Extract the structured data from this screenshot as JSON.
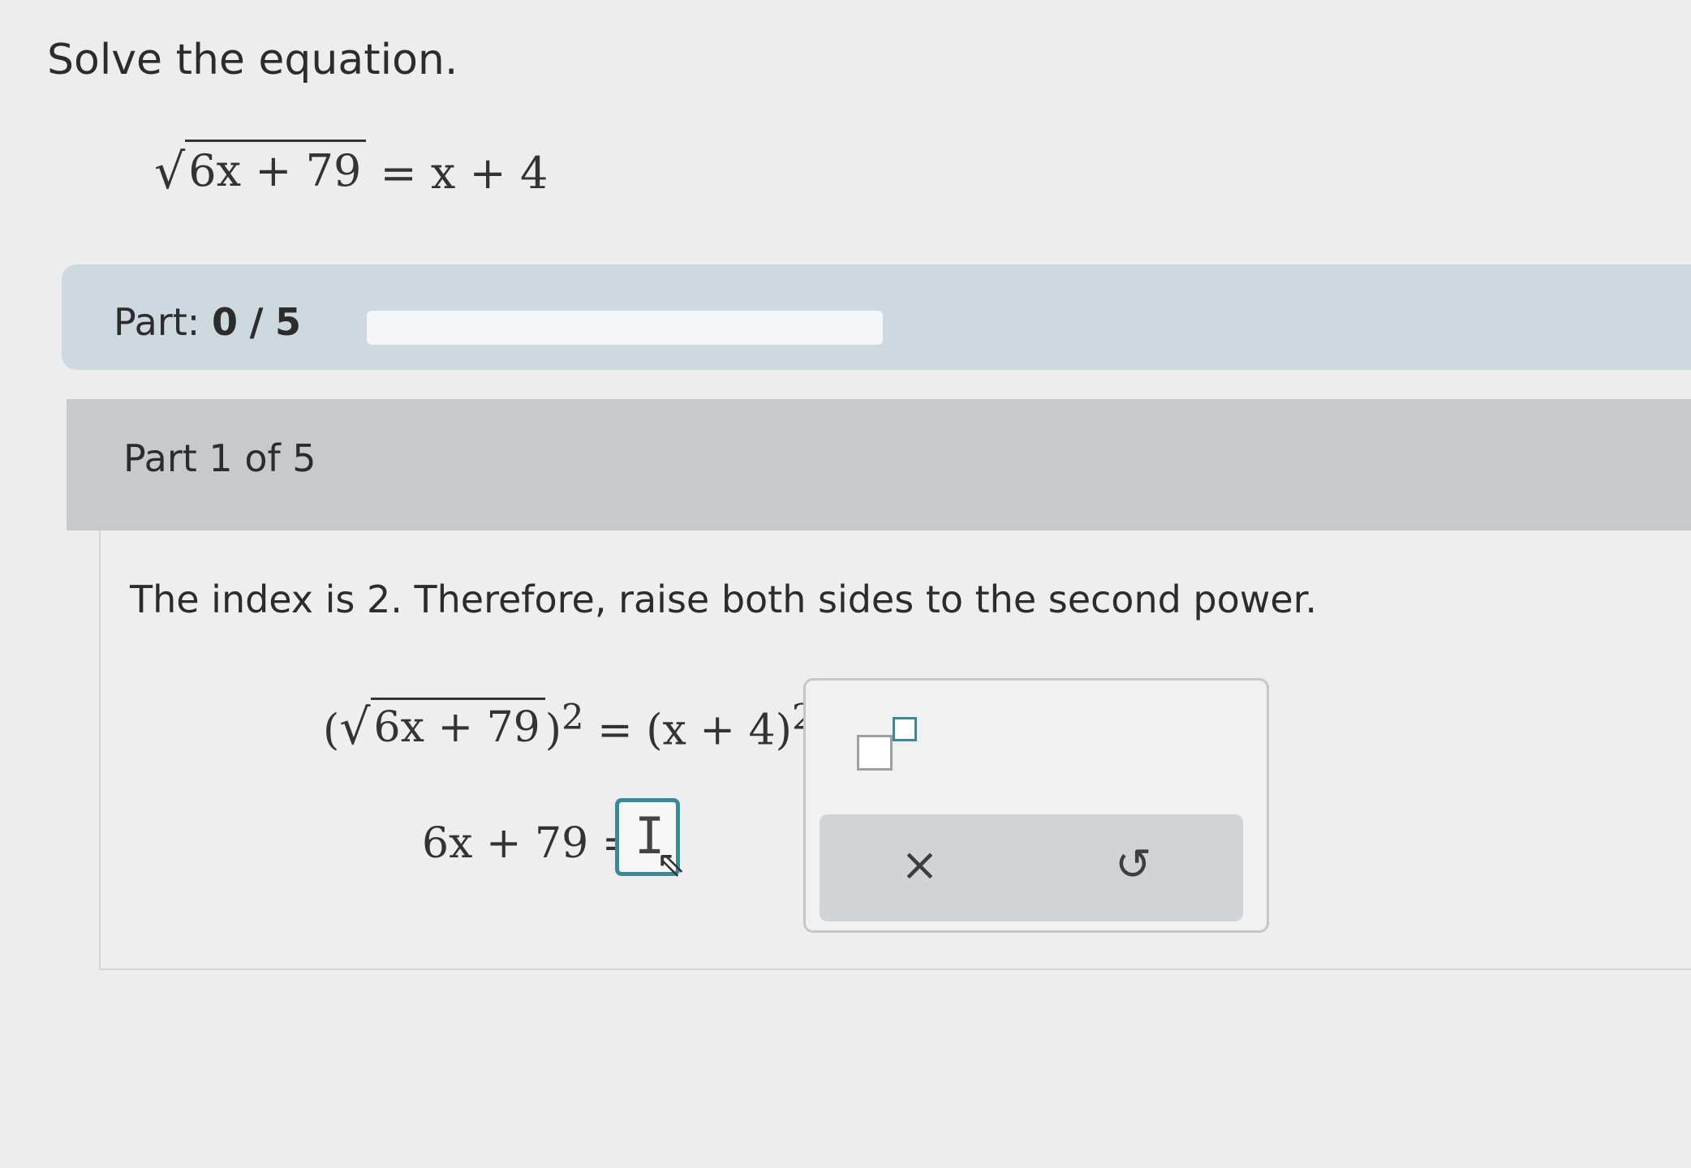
{
  "problem": {
    "title": "Solve the equation.",
    "equation": {
      "radicand": "6x + 79",
      "rhs": "= x + 4"
    }
  },
  "progress": {
    "part_prefix": "Part:",
    "current": "0",
    "separator": "/",
    "total": "5",
    "fill_fraction": 0
  },
  "step": {
    "heading": "Part 1 of 5",
    "instruction": "The index is 2. Therefore, raise both sides to the second power.",
    "squared_equation": {
      "radicand": "6x + 79",
      "exponent": "2",
      "rhs": "= (x + 4)",
      "rhs_exponent": "2"
    },
    "answer_prompt": "6x + 79 ="
  },
  "palette": {
    "superscript_icon": "superscript-template-icon",
    "clear_label": "×",
    "undo_label": "↺"
  },
  "colors": {
    "accent": "#3a8a96",
    "part_bar": "#cdd8df",
    "step_header": "#c6cacc"
  }
}
